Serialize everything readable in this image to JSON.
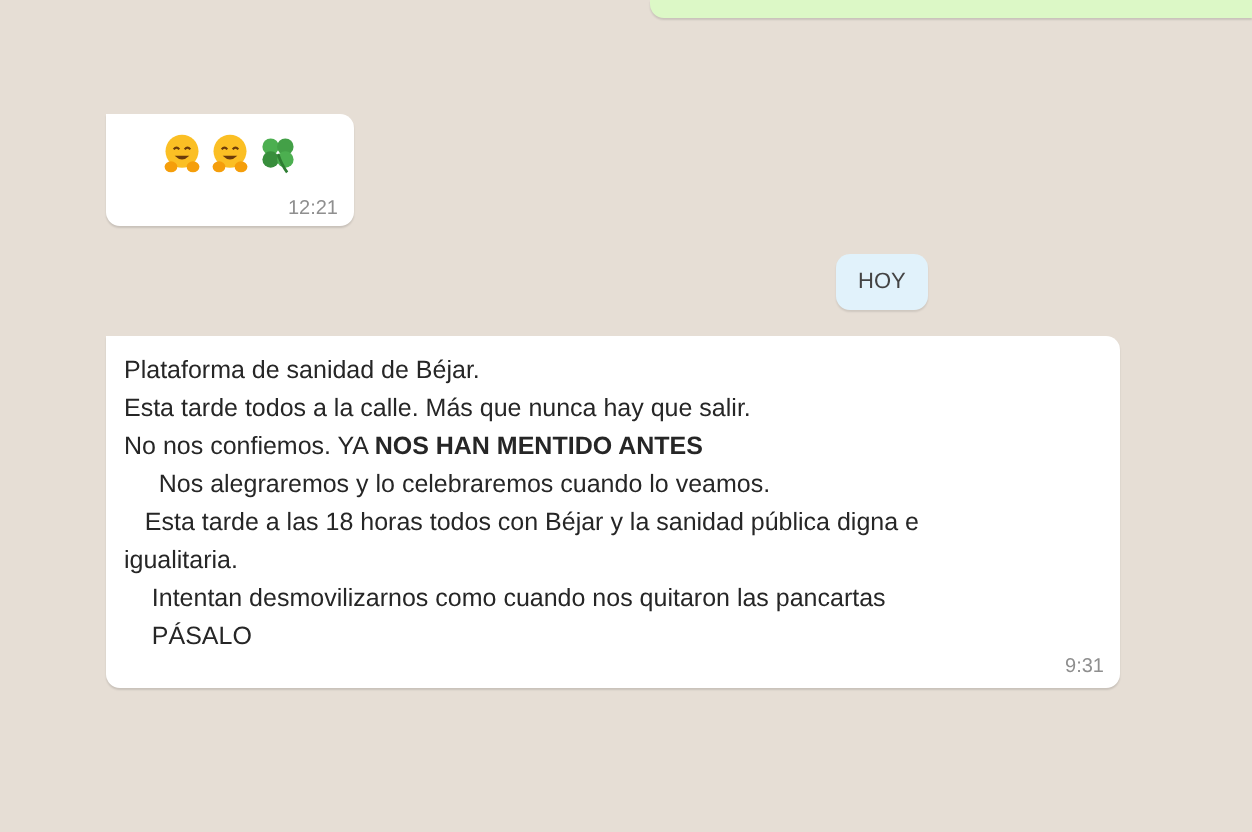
{
  "messages": [
    {
      "kind": "outgoing"
    },
    {
      "kind": "emoji",
      "emojis": [
        {
          "kind": "hug"
        },
        {
          "kind": "hug"
        },
        {
          "kind": "clover"
        }
      ],
      "time": "12:21"
    },
    {
      "kind": "date",
      "label": "HOY"
    },
    {
      "kind": "text",
      "lines": [
        "Plataforma de sanidad de Béjar.",
        "Esta tarde todos a la calle. Más que nunca hay que salir.",
        "No nos confiemos. YA **NOS HAN MENTIDO ANTES**",
        "     Nos alegraremos y lo celebraremos cuando lo veamos.",
        "   Esta tarde a las 18 horas todos con Béjar y la sanidad pública digna e igualitaria.",
        "    Intentan desmovilizarnos como cuando nos quitaron las pancartas",
        "    PÁSALO"
      ],
      "time": "9:31"
    }
  ]
}
